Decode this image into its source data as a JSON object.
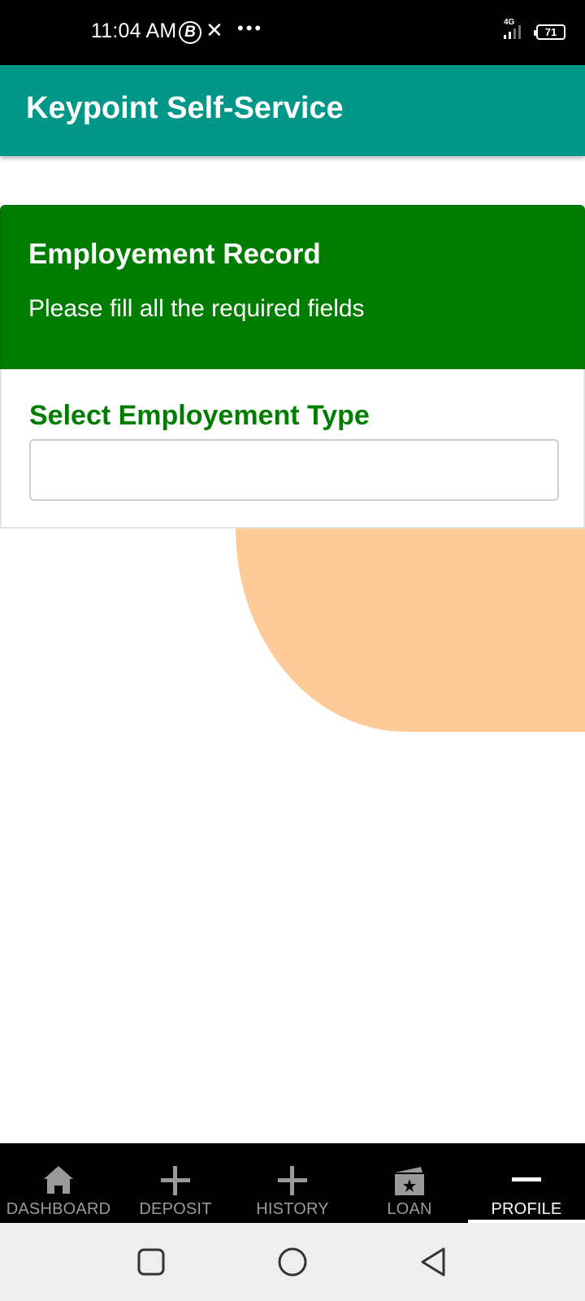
{
  "status_bar": {
    "time": "11:04 AM",
    "notification_icons": [
      "b-circle-icon",
      "x-icon",
      "more-dots-icon"
    ],
    "network_label": "4G",
    "battery_level": "71"
  },
  "app_bar": {
    "title": "Keypoint Self-Service",
    "color": "#009688"
  },
  "card": {
    "title": "Employement Record",
    "subtitle": "Please fill all the required fields",
    "header_color": "#007d00",
    "field": {
      "label": "Select Employement Type",
      "value": ""
    }
  },
  "decoration": {
    "blob_color": "#fecb98"
  },
  "bottom_nav": {
    "items": [
      {
        "label": "DASHBOARD",
        "icon": "home-icon",
        "active": false
      },
      {
        "label": "DEPOSIT",
        "icon": "plus-icon",
        "active": false
      },
      {
        "label": "HISTORY",
        "icon": "plus-icon",
        "active": false
      },
      {
        "label": "LOAN",
        "icon": "card-star-icon",
        "active": false
      },
      {
        "label": "PROFILE",
        "icon": "minus-icon",
        "active": true
      }
    ]
  },
  "system_nav": {
    "buttons": [
      "recents-icon",
      "home-circle-icon",
      "back-triangle-icon"
    ]
  }
}
